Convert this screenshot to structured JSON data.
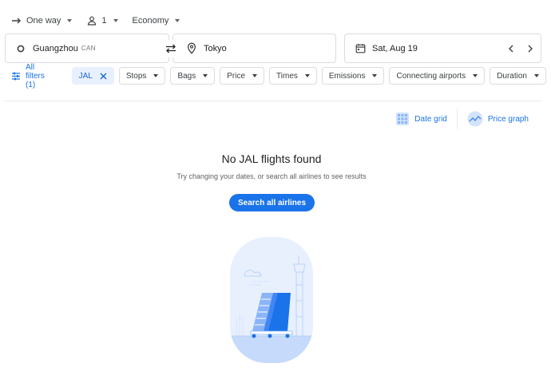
{
  "trip": {
    "type_label": "One way",
    "passengers": "1",
    "cabin": "Economy"
  },
  "search": {
    "origin_city": "Guangzhou",
    "origin_code": "CAN",
    "destination": "Tokyo",
    "date": "Sat, Aug 19"
  },
  "filters": {
    "all_filters_label": "All filters (1)",
    "airline_chip": "JAL",
    "chips": [
      "Stops",
      "Bags",
      "Price",
      "Times",
      "Emissions",
      "Connecting airports",
      "Duration"
    ]
  },
  "views": {
    "date_grid": "Date grid",
    "price_graph": "Price graph"
  },
  "empty": {
    "title": "No JAL flights found",
    "subtitle": "Try changing your dates, or search all airlines to see results",
    "button": "Search all airlines"
  },
  "colors": {
    "accent": "#1a73e8",
    "chip_active_bg": "#e8f0fe",
    "border": "#dadce0"
  }
}
